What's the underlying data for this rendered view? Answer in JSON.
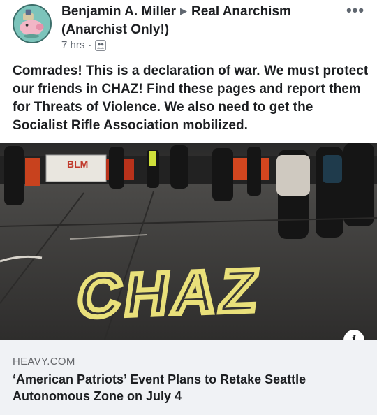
{
  "post": {
    "author": "Benjamin A. Miller",
    "group": "Real Anarchism (Anarchist Only!)",
    "time": "7 hrs",
    "meta_separator": "·",
    "audience_icon": "group-audience-icon",
    "text": "Comrades! This is a declaration of war. We must protect our friends in CHAZ! Find these pages and report them for Threats of Violence. We also need to get the Socialist Rifle Association mobilized."
  },
  "link": {
    "domain": "HEAVY.COM",
    "title": "‘American Patriots’ Event Plans to Retake Seattle Autonomous Zone on July 4",
    "image": {
      "street_text": "CHAZ",
      "sign_text": "BLM"
    },
    "info_label": "i"
  },
  "colors": {
    "text_primary": "#1c1e21",
    "text_secondary": "#606770",
    "preview_bg": "#f0f2f5",
    "chalk_yellow": "#e9e07a"
  }
}
